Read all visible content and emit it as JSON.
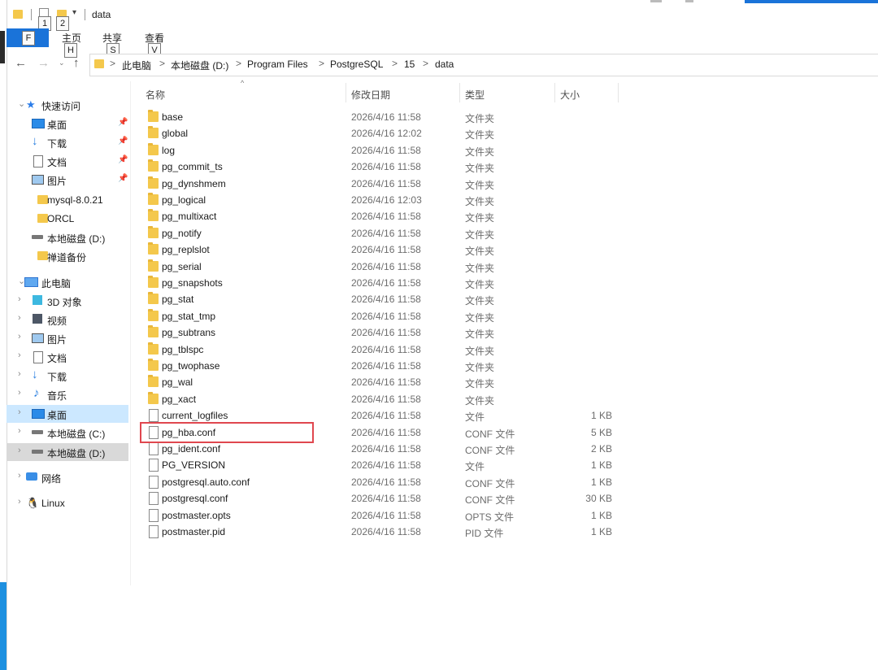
{
  "window": {
    "title": "data"
  },
  "quick_access_tips": [
    "1",
    "2"
  ],
  "ribbon": {
    "file_tip": "F",
    "tabs": [
      {
        "label": "主页",
        "tip": "H"
      },
      {
        "label": "共享",
        "tip": "S"
      },
      {
        "label": "查看",
        "tip": "V"
      }
    ]
  },
  "address": {
    "crumbs": [
      "此电脑",
      "本地磁盘 (D:)",
      "Program Files",
      "PostgreSQL",
      "15",
      "data"
    ],
    "separator": ">"
  },
  "sidebar": {
    "quick_access": {
      "label": "快速访问"
    },
    "quick_items": [
      {
        "label": "桌面",
        "icon": "desktop-icon",
        "pinned": true
      },
      {
        "label": "下载",
        "icon": "download-icon",
        "pinned": true
      },
      {
        "label": "文档",
        "icon": "document-icon",
        "pinned": true
      },
      {
        "label": "图片",
        "icon": "picture-icon",
        "pinned": true
      },
      {
        "label": "mysql-8.0.21",
        "icon": "folder-icon",
        "pinned": false
      },
      {
        "label": "ORCL",
        "icon": "folder-icon",
        "pinned": false
      },
      {
        "label": "本地磁盘 (D:)",
        "icon": "drive-icon",
        "pinned": false
      },
      {
        "label": "禅道备份",
        "icon": "folder-icon",
        "pinned": false
      }
    ],
    "this_pc": {
      "label": "此电脑"
    },
    "pc_items": [
      {
        "label": "3D 对象",
        "icon": "cube-icon"
      },
      {
        "label": "视频",
        "icon": "video-icon"
      },
      {
        "label": "图片",
        "icon": "picture-icon"
      },
      {
        "label": "文档",
        "icon": "document-icon"
      },
      {
        "label": "下载",
        "icon": "download-icon"
      },
      {
        "label": "音乐",
        "icon": "music-icon"
      },
      {
        "label": "桌面",
        "icon": "desktop-icon"
      },
      {
        "label": "本地磁盘 (C:)",
        "icon": "drive-icon"
      },
      {
        "label": "本地磁盘 (D:)",
        "icon": "drive-icon"
      }
    ],
    "network": {
      "label": "网络"
    },
    "linux": {
      "label": "Linux"
    }
  },
  "columns": {
    "name": "名称",
    "modified": "修改日期",
    "type": "类型",
    "size": "大小"
  },
  "files": [
    {
      "name": "base",
      "date": "2026/4/16 11:58",
      "type": "文件夹",
      "size": "",
      "kind": "folder"
    },
    {
      "name": "global",
      "date": "2026/4/16 12:02",
      "type": "文件夹",
      "size": "",
      "kind": "folder"
    },
    {
      "name": "log",
      "date": "2026/4/16 11:58",
      "type": "文件夹",
      "size": "",
      "kind": "folder"
    },
    {
      "name": "pg_commit_ts",
      "date": "2026/4/16 11:58",
      "type": "文件夹",
      "size": "",
      "kind": "folder"
    },
    {
      "name": "pg_dynshmem",
      "date": "2026/4/16 11:58",
      "type": "文件夹",
      "size": "",
      "kind": "folder"
    },
    {
      "name": "pg_logical",
      "date": "2026/4/16 12:03",
      "type": "文件夹",
      "size": "",
      "kind": "folder"
    },
    {
      "name": "pg_multixact",
      "date": "2026/4/16 11:58",
      "type": "文件夹",
      "size": "",
      "kind": "folder"
    },
    {
      "name": "pg_notify",
      "date": "2026/4/16 11:58",
      "type": "文件夹",
      "size": "",
      "kind": "folder"
    },
    {
      "name": "pg_replslot",
      "date": "2026/4/16 11:58",
      "type": "文件夹",
      "size": "",
      "kind": "folder"
    },
    {
      "name": "pg_serial",
      "date": "2026/4/16 11:58",
      "type": "文件夹",
      "size": "",
      "kind": "folder"
    },
    {
      "name": "pg_snapshots",
      "date": "2026/4/16 11:58",
      "type": "文件夹",
      "size": "",
      "kind": "folder"
    },
    {
      "name": "pg_stat",
      "date": "2026/4/16 11:58",
      "type": "文件夹",
      "size": "",
      "kind": "folder"
    },
    {
      "name": "pg_stat_tmp",
      "date": "2026/4/16 11:58",
      "type": "文件夹",
      "size": "",
      "kind": "folder"
    },
    {
      "name": "pg_subtrans",
      "date": "2026/4/16 11:58",
      "type": "文件夹",
      "size": "",
      "kind": "folder"
    },
    {
      "name": "pg_tblspc",
      "date": "2026/4/16 11:58",
      "type": "文件夹",
      "size": "",
      "kind": "folder"
    },
    {
      "name": "pg_twophase",
      "date": "2026/4/16 11:58",
      "type": "文件夹",
      "size": "",
      "kind": "folder"
    },
    {
      "name": "pg_wal",
      "date": "2026/4/16 11:58",
      "type": "文件夹",
      "size": "",
      "kind": "folder"
    },
    {
      "name": "pg_xact",
      "date": "2026/4/16 11:58",
      "type": "文件夹",
      "size": "",
      "kind": "folder"
    },
    {
      "name": "current_logfiles",
      "date": "2026/4/16 11:58",
      "type": "文件",
      "size": "1 KB",
      "kind": "file"
    },
    {
      "name": "pg_hba.conf",
      "date": "2026/4/16 11:58",
      "type": "CONF 文件",
      "size": "5 KB",
      "kind": "file"
    },
    {
      "name": "pg_ident.conf",
      "date": "2026/4/16 11:58",
      "type": "CONF 文件",
      "size": "2 KB",
      "kind": "file"
    },
    {
      "name": "PG_VERSION",
      "date": "2026/4/16 11:58",
      "type": "文件",
      "size": "1 KB",
      "kind": "file"
    },
    {
      "name": "postgresql.auto.conf",
      "date": "2026/4/16 11:58",
      "type": "CONF 文件",
      "size": "1 KB",
      "kind": "file"
    },
    {
      "name": "postgresql.conf",
      "date": "2026/4/16 11:58",
      "type": "CONF 文件",
      "size": "30 KB",
      "kind": "file"
    },
    {
      "name": "postmaster.opts",
      "date": "2026/4/16 11:58",
      "type": "OPTS 文件",
      "size": "1 KB",
      "kind": "file"
    },
    {
      "name": "postmaster.pid",
      "date": "2026/4/16 11:58",
      "type": "PID 文件",
      "size": "1 KB",
      "kind": "file"
    }
  ],
  "highlighted_file": "pg_hba.conf",
  "colors": {
    "accent": "#1a73d9",
    "folder": "#f4c84c",
    "highlight_box": "#e0474f",
    "selection": "#cce8ff"
  }
}
